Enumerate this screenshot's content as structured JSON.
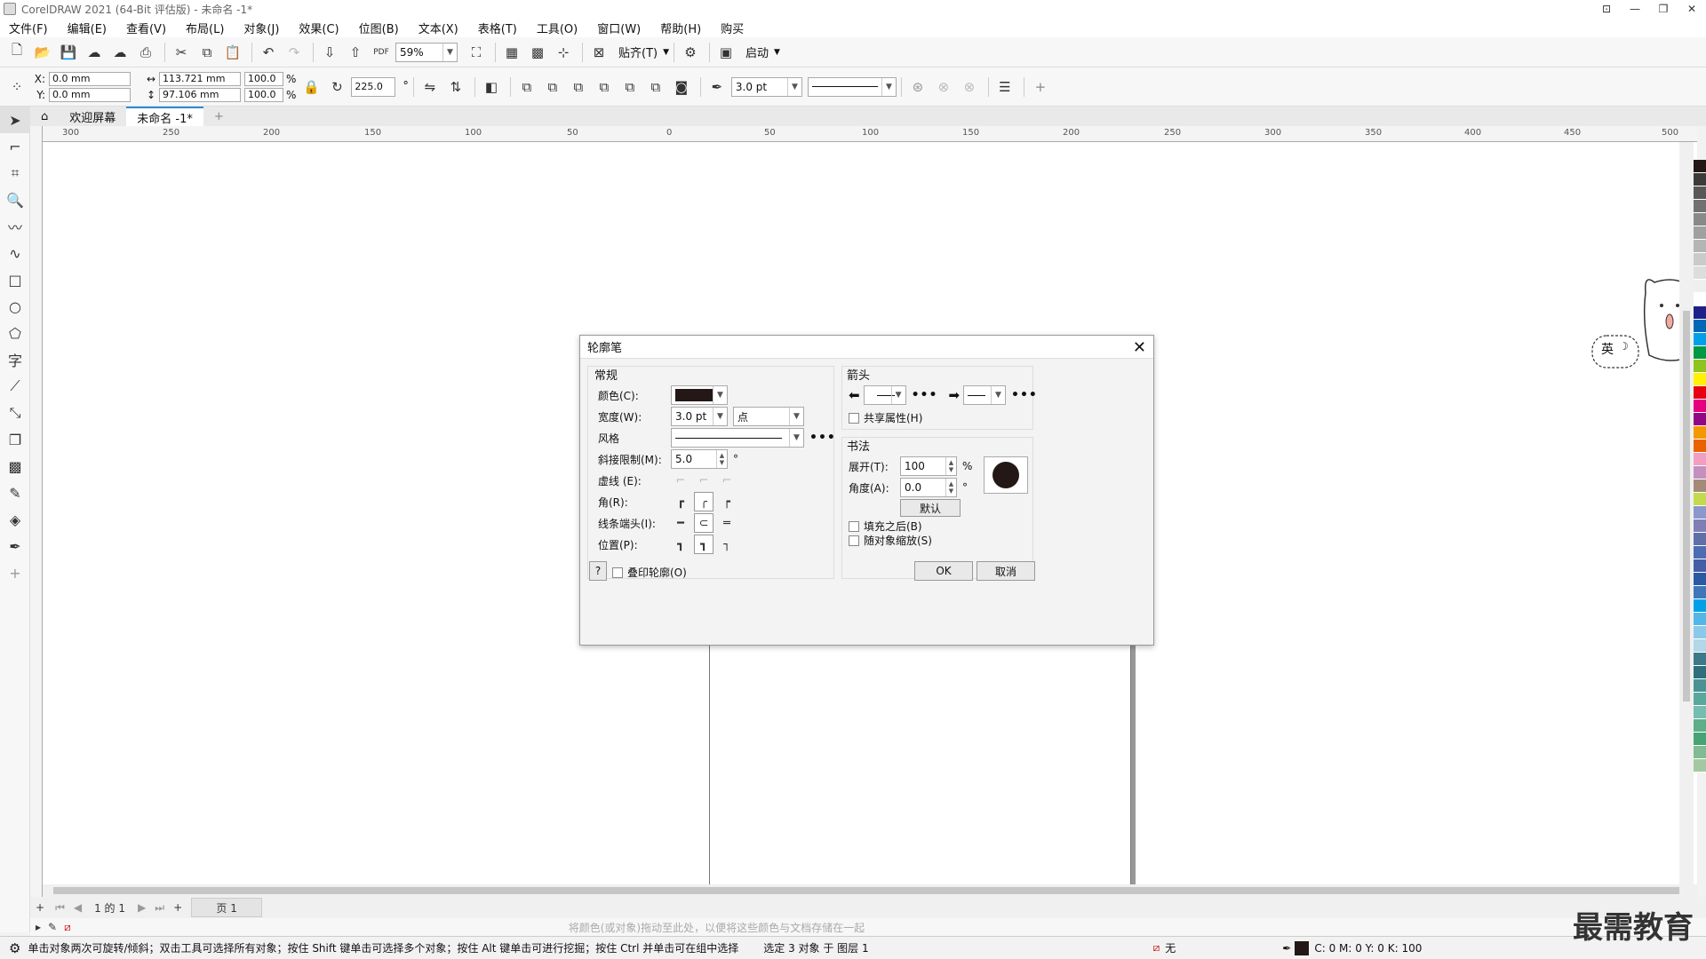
{
  "title": "CorelDRAW 2021 (64-Bit 评估版) - 未命名 -1*",
  "menu": [
    "文件(F)",
    "编辑(E)",
    "查看(V)",
    "布局(L)",
    "对象(J)",
    "效果(C)",
    "位图(B)",
    "文本(X)",
    "表格(T)",
    "工具(O)",
    "窗口(W)",
    "帮助(H)",
    "购买"
  ],
  "toolbar": {
    "zoom": "59%",
    "snap_label": "贴齐(T)",
    "launch_label": "启动"
  },
  "propbar": {
    "x_label": "X:",
    "x_value": "0.0 mm",
    "y_label": "Y:",
    "y_value": "0.0 mm",
    "w_value": "113.721 mm",
    "h_value": "97.106 mm",
    "scale_w": "100.0",
    "scale_h": "100.0",
    "pct": "%",
    "rotation": "225.0",
    "outline_width": "3.0 pt"
  },
  "tabs": {
    "welcome": "欢迎屏幕",
    "doc": "未命名 -1*"
  },
  "ruler_ticks": [
    "300",
    "250",
    "200",
    "150",
    "100",
    "50",
    "0",
    "50",
    "100",
    "150",
    "200",
    "250",
    "300",
    "350",
    "400",
    "450",
    "500"
  ],
  "dialog": {
    "title": "轮廓笔",
    "general": "常规",
    "color_label": "颜色(C):",
    "width_label": "宽度(W):",
    "width_value": "3.0 pt",
    "unit_value": "点",
    "style_label": "风格",
    "miter_label": "斜接限制(M):",
    "miter_value": "5.0",
    "degree": "°",
    "dash_label": "虚线 (E):",
    "corner_label": "角(R):",
    "cap_label": "线条端头(I):",
    "position_label": "位置(P):",
    "arrows": "箭头",
    "share_attr": "共享属性(H)",
    "calligraphy": "书法",
    "stretch_label": "展开(T):",
    "stretch_value": "100",
    "stretch_unit": "%",
    "angle_label": "角度(A):",
    "angle_value": "0.0",
    "default_btn": "默认",
    "behind_fill": "填充之后(B)",
    "scale_with": "随对象缩放(S)",
    "help": "?",
    "overprint": "叠印轮廓(O)",
    "ok": "OK",
    "cancel": "取消",
    "color_swatch": "#231815"
  },
  "pagenav": {
    "page_of": "1 的 1",
    "page_tab": "页 1"
  },
  "colorhint": "将颜色(或对象)拖动至此处，以便将这些颜色与文档存储在一起",
  "status": {
    "hint": "单击对象两次可旋转/倾斜；双击工具可选择所有对象；按住 Shift 键单击可选择多个对象；按住 Alt 键单击可进行挖掘；按住 Ctrl 并单击可在组中选择",
    "selection": "选定 3 对象 于 图层 1",
    "fill": "无",
    "cmyk": "C: 0 M: 0 Y: 0 K: 100"
  },
  "ime": "英",
  "watermark": "最需教育",
  "palette": [
    "#231815",
    "#3e3a39",
    "#595757",
    "#727171",
    "#898989",
    "#9fa0a0",
    "#b5b5b6",
    "#c9caca",
    "#dcdddd",
    "#efefef",
    "#ffffff",
    "#1d2088",
    "#0068b7",
    "#00a0e9",
    "#009944",
    "#8fc31f",
    "#fff100",
    "#e60012",
    "#e4007f",
    "#920783",
    "#f39800",
    "#eb6100",
    "#f19ec2",
    "#c490bf",
    "#a48b78",
    "#c3d94e",
    "#8c97cb",
    "#7f7fb5",
    "#5f6fa8",
    "#4c6cb3",
    "#465da7",
    "#2b5aa5",
    "#3e77b9",
    "#00a1e9",
    "#53b6e7",
    "#8bc9e9",
    "#b3d6e8",
    "#3c7a89",
    "#2f6f7c",
    "#4b9295",
    "#5aa89c",
    "#75bdb1",
    "#5eae8a",
    "#46a374",
    "#80bb94",
    "#a3c9a3"
  ]
}
